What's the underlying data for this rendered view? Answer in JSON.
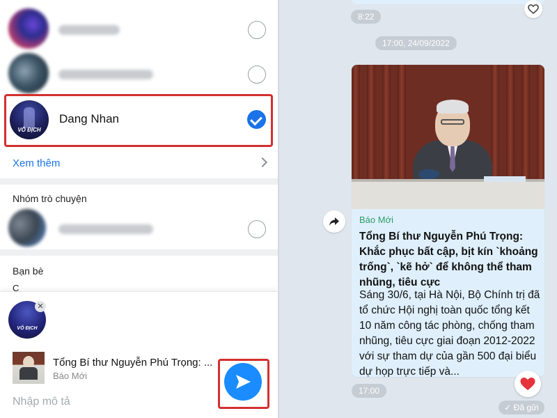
{
  "share_sheet": {
    "contacts": [
      {
        "name": "Trung Hiếu",
        "selected": false,
        "blurred": true
      },
      {
        "name": "Đặng Ngọc Nhân",
        "selected": false,
        "blurred": true
      },
      {
        "name": "Dang Nhan",
        "selected": true,
        "blurred": false
      }
    ],
    "avatar_caption": "VÔ ĐỊCH",
    "see_more_label": "Xem thêm",
    "group_section_title": "Nhóm trò chuyện",
    "groups": [
      {
        "name": "XZ điểm 10 HS",
        "selected": false,
        "blurred": true
      }
    ],
    "friends_section_title": "Bạn bè",
    "friends_index_letter": "C",
    "selected_recipient_remove": "✕",
    "shared_item": {
      "title": "Tổng Bí thư Nguyễn Phú Trọng: ...",
      "source": "Báo Mới"
    },
    "description_placeholder": "Nhập mô tả",
    "send_button_icon": "send-icon"
  },
  "chat": {
    "time_top": "8:22",
    "date_separator": "17:00, 24/09/2022",
    "news_card": {
      "source": "Báo Mới",
      "title": "Tổng Bí thư Nguyễn Phú Trọng: Khắc phục bất cập, bịt kín `khoảng trống`, `kẽ hở` để không thể tham nhũng, tiêu cực",
      "description": "Sáng 30/6, tại Hà Nội, Bộ Chính trị đã tổ chức Hội nghị toàn quốc tổng kết 10 năm công tác phòng, chống tham nhũng, tiêu cực giai đoạn 2012-2022 với sự tham dự của gần 500 đại biểu dự họp trực tiếp và..."
    },
    "time_bottom": "17:00",
    "status": "✓ Đã gửi"
  },
  "colors": {
    "accent_blue": "#1a73e8",
    "send_blue": "#1a8cff",
    "highlight_red": "#d32f2f",
    "source_green": "#2e9b66",
    "chat_bg": "#dfe6ee",
    "bubble_bg": "#dff0fc"
  }
}
